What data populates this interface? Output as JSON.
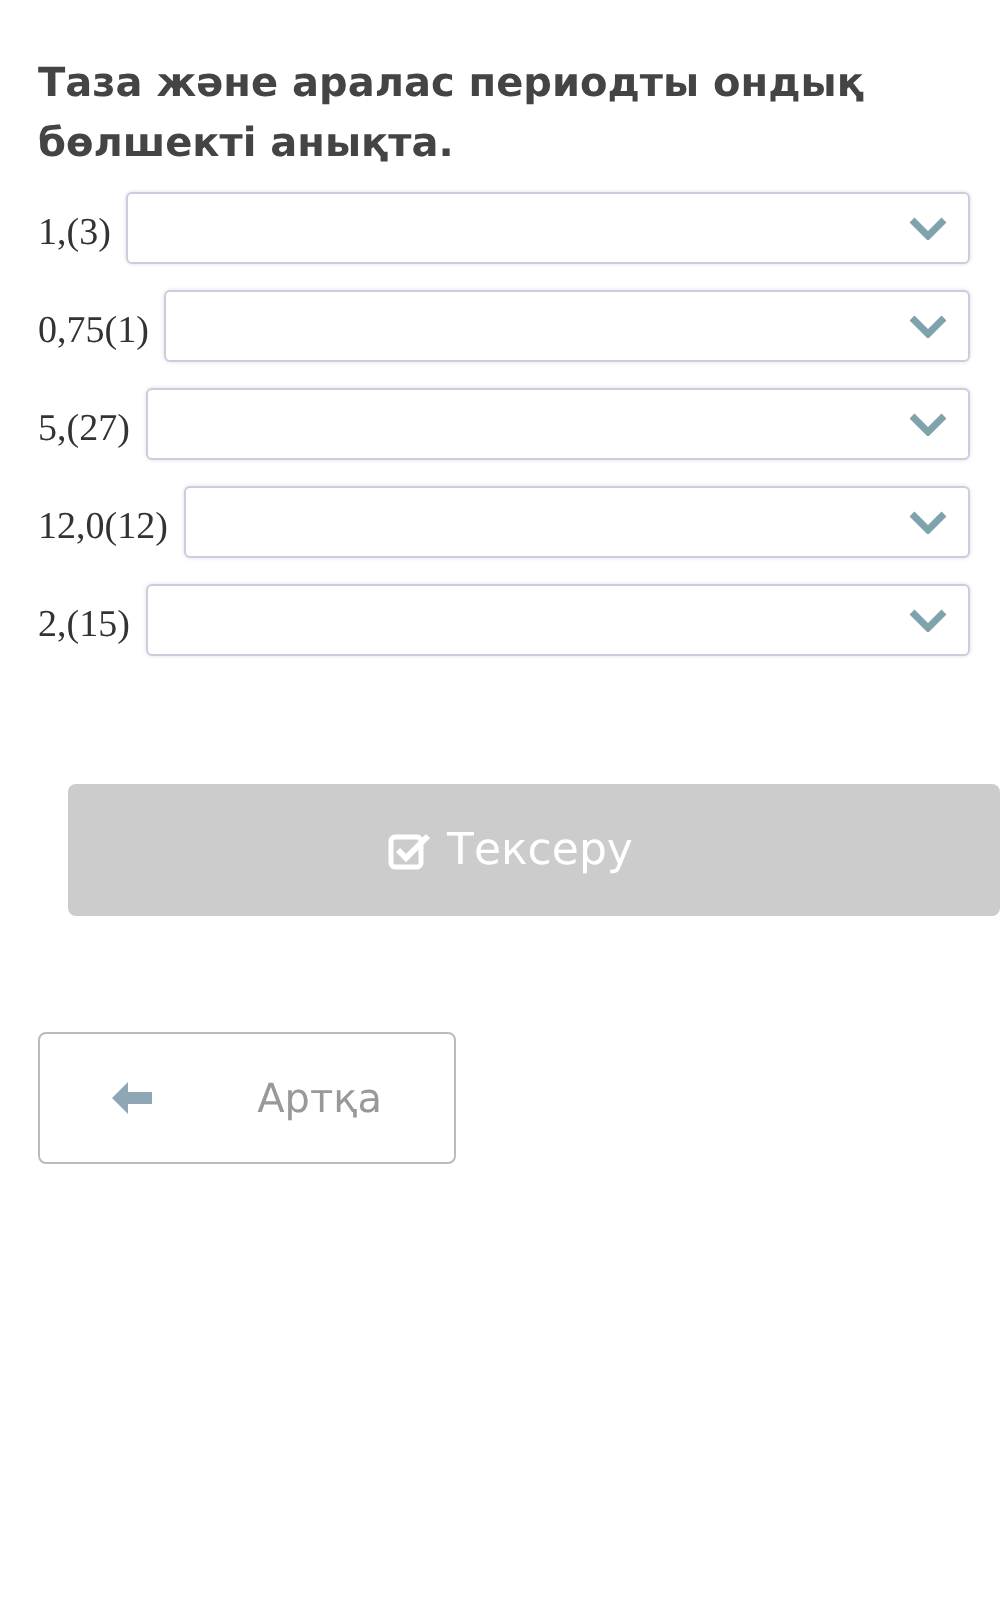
{
  "title": "Таза және аралас периодты ондық бөлшекті анықта.",
  "rows": [
    {
      "label": "1,(3)"
    },
    {
      "label": "0,75(1)"
    },
    {
      "label": "5,(27)"
    },
    {
      "label": "12,0(12)"
    },
    {
      "label": "2,(15)"
    }
  ],
  "check_button": {
    "label": "Тексеру",
    "disabled": true
  },
  "back_button": {
    "label": "Артқа"
  }
}
